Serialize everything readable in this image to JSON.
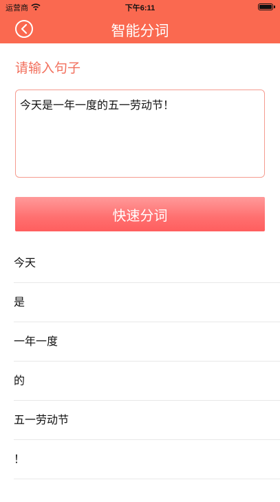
{
  "status_bar": {
    "carrier": "运营商",
    "time": "下午6:11"
  },
  "nav": {
    "title": "智能分词"
  },
  "form": {
    "prompt": "请输入句子",
    "input_value": "今天是一年一度的五一劳动节！",
    "submit_label": "快速分词"
  },
  "results": [
    "今天",
    "是",
    "一年一度",
    "的",
    "五一劳动节",
    "！"
  ],
  "colors": {
    "accent": "#fa6950",
    "button": "#ff6f6f"
  }
}
